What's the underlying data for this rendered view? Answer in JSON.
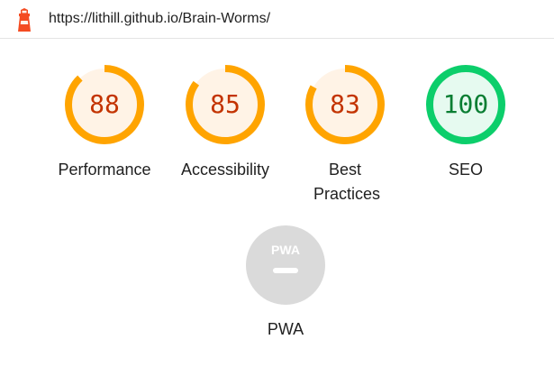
{
  "url": "https://lithill.github.io/Brain-Worms/",
  "icons": {
    "logo": "lighthouse-icon",
    "pwa": "pwa-icon"
  },
  "colors": {
    "average": "#ffa400",
    "average_fill": "#fff3e6",
    "average_text": "#c33300",
    "pass": "#0cce6b",
    "pass_fill": "#e6faf0",
    "pass_text": "#0a7e33",
    "pwa_gray": "#dadada"
  },
  "gauges": [
    {
      "score": "88",
      "value": 88,
      "label": "Performance"
    },
    {
      "score": "85",
      "value": 85,
      "label": "Accessibility"
    },
    {
      "score": "83",
      "value": 83,
      "label": "Best Practices"
    },
    {
      "score": "100",
      "value": 100,
      "label": "SEO"
    }
  ],
  "pwa": {
    "badge_text": "PWA",
    "label": "PWA"
  }
}
